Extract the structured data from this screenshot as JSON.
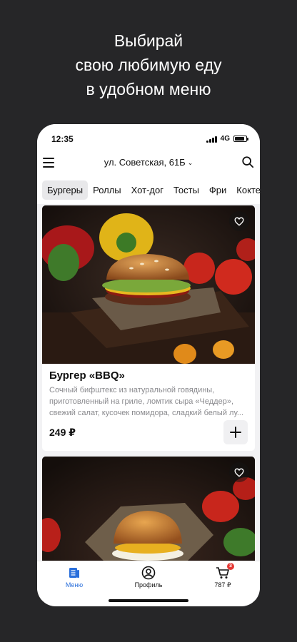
{
  "promo": {
    "line1": "Выбирай",
    "line2": "свою любимую еду",
    "line3": "в удобном меню"
  },
  "status_bar": {
    "time": "12:35",
    "network": "4G"
  },
  "header": {
    "address": "ул. Советская, 61Б",
    "menu_icon": "hamburger-menu-icon",
    "search_icon": "search-icon"
  },
  "categories": [
    {
      "label": "Бургеры",
      "active": true
    },
    {
      "label": "Роллы",
      "active": false
    },
    {
      "label": "Хот-дог",
      "active": false
    },
    {
      "label": "Тосты",
      "active": false
    },
    {
      "label": "Фри",
      "active": false
    },
    {
      "label": "Коктейли",
      "active": false
    }
  ],
  "products": [
    {
      "title": "Бургер «BBQ»",
      "description": "Сочный бифштекс из натуральной говядины, приготовленный на гриле, ломтик сыра «Чеддер», свежий салат, кусочек помидора, сладкий белый лу...",
      "price": "249 ₽"
    },
    {
      "title": "",
      "description": "",
      "price": ""
    }
  ],
  "bottom_nav": {
    "menu_label": "Меню",
    "profile_label": "Профиль",
    "cart_label": "787 ₽",
    "cart_badge": "3"
  },
  "colors": {
    "background": "#262628",
    "accent": "#2a6fdb",
    "badge": "#e53935"
  }
}
